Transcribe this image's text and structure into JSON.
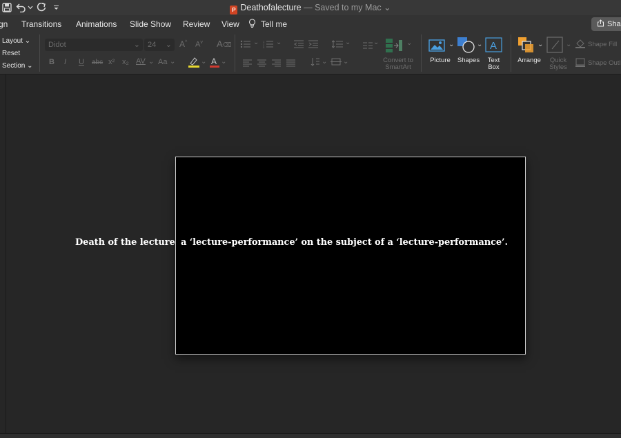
{
  "document": {
    "filename": "Deathofalecture",
    "saved_status": "— Saved to my Mac"
  },
  "tabs": [
    "gn",
    "Transitions",
    "Animations",
    "Slide Show",
    "Review",
    "View",
    "Tell me"
  ],
  "share": "Shar",
  "ribbon": {
    "slides_group": {
      "layout": "Layout",
      "reset": "Reset",
      "section": "Section"
    },
    "font": {
      "name": "Didot",
      "size": "24"
    },
    "font_buttons": [
      "B",
      "I",
      "U",
      "abc",
      "x²",
      "x₂",
      "AV",
      "Aa"
    ],
    "smartart": {
      "line1": "Convert to",
      "line2": "SmartArt"
    },
    "insert": {
      "picture": "Picture",
      "shapes": "Shapes",
      "textbox_line1": "Text",
      "textbox_line2": "Box"
    },
    "arrange": "Arrange",
    "quick_styles": {
      "line1": "Quick",
      "line2": "Styles"
    },
    "shape_fill": "Shape Fill",
    "shape_outline": "Shape Outli"
  },
  "slide": {
    "outside_text": "Death of the lecture",
    "body_text": "a ‘lecture-performance’ on the subject of a ‘lecture-performance’."
  },
  "colors": {
    "app_bg": "#262626",
    "ribbon_bg": "#333333",
    "slide_bg": "#000000",
    "ppt_accent": "#d04423",
    "picture_icon": "#4a9fe0",
    "arrange_icon": "#f0a030"
  }
}
